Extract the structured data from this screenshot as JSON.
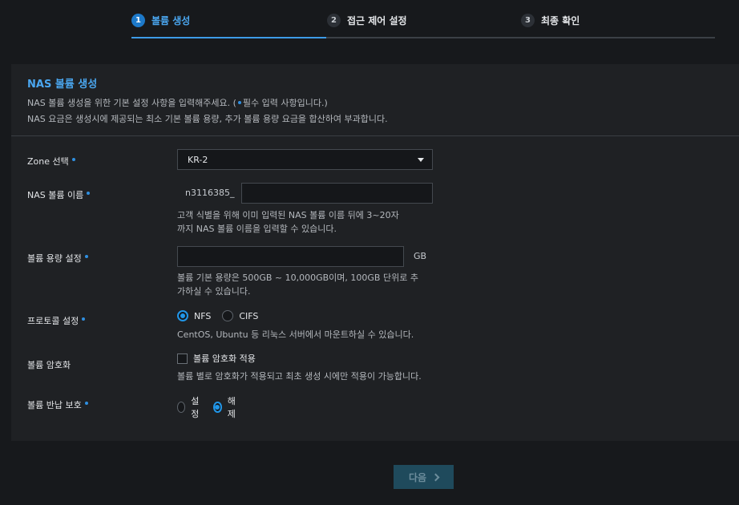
{
  "stepper": {
    "steps": [
      {
        "num": "1",
        "label": "볼륨 생성"
      },
      {
        "num": "2",
        "label": "접근 제어 설정"
      },
      {
        "num": "3",
        "label": "최종 확인"
      }
    ],
    "active_step": 1
  },
  "panel": {
    "title": "NAS 볼륨 생성",
    "desc_line1_a": "NAS 볼륨 생성을 위한 기본 설정 사항을 입력해주세요. (",
    "desc_line1_b": "필수 입력 사항입니다.)",
    "desc_line2": "NAS 요금은 생성시에 제공되는 최소 기본 볼륨 용량, 추가 볼륨 용량 요금을 합산하여 부과합니다."
  },
  "form": {
    "zone": {
      "label": "Zone 선택",
      "value": "KR-2"
    },
    "name": {
      "label": "NAS 볼륨 이름",
      "prefix": "n3116385_",
      "value": "",
      "help1": "고객 식별을 위해 이미 입력된 NAS 볼륨 이름 뒤에 3~20자",
      "help2": "까지 NAS 볼륨 이름을 입력할 수 있습니다."
    },
    "capacity": {
      "label": "볼륨 용량 설정",
      "value": "",
      "unit": "GB",
      "help1": "볼륨 기본 용량은 500GB ~ 10,000GB이며, 100GB 단위로 추",
      "help2": "가하실 수 있습니다."
    },
    "protocol": {
      "label": "프로토콜 설정",
      "options": [
        "NFS",
        "CIFS"
      ],
      "selected": "NFS",
      "help": "CentOS, Ubuntu 등 리눅스 서버에서 마운트하실 수 있습니다."
    },
    "encryption": {
      "label": "볼륨 암호화",
      "checkbox_label": "볼륨 암호화 적용",
      "checked": false,
      "help": "볼륨 별로 암호화가 적용되고 최초 생성 시에만 적용이 가능합니다."
    },
    "return_protect": {
      "label": "볼륨 반납 보호",
      "options": [
        "설정",
        "해제"
      ],
      "selected": "해제"
    }
  },
  "footer": {
    "next_label": "다음"
  },
  "colors": {
    "accent": "#3d9be6",
    "required_dot": "#2f8fe0",
    "panel_bg": "#1f2124",
    "page_bg": "#17191c"
  }
}
